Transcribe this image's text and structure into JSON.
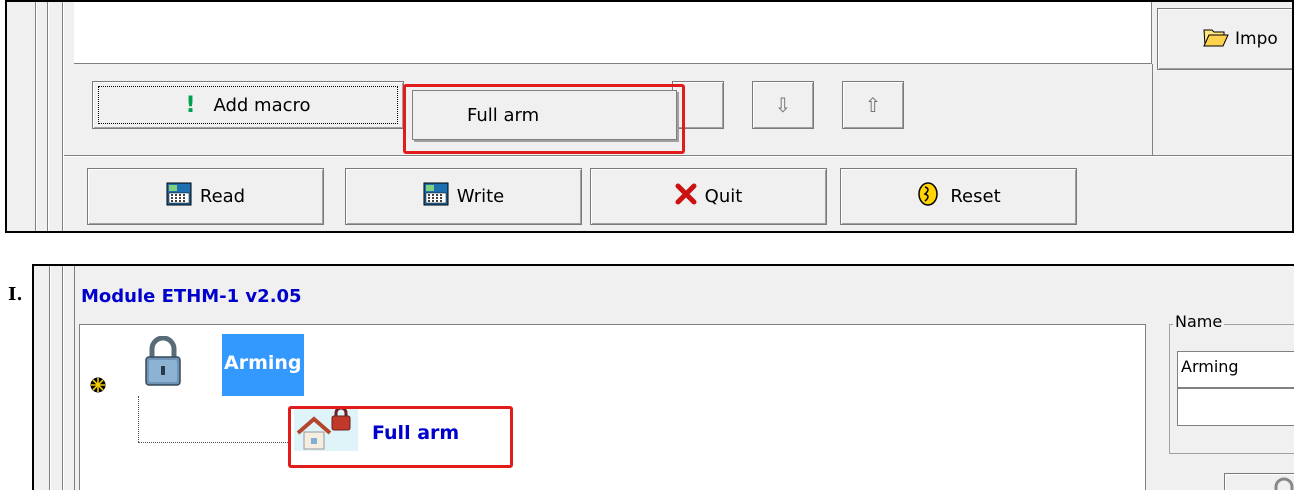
{
  "top_panel": {
    "import_button_label": "Impo",
    "add_macro_label": "Add macro",
    "dropdown_item": "Full arm",
    "arrow_down_symbol": "⇩",
    "arrow_up_symbol": "⇧",
    "read_label": "Read",
    "write_label": "Write",
    "quit_label": "Quit",
    "reset_label": "Reset"
  },
  "bottom_panel": {
    "left_letter": "I.",
    "module_title": "Module ETHM-1 v2.05",
    "tree_root": "Arming",
    "tree_child": "Full arm",
    "name_group_label": "Name",
    "name_value": "Arming",
    "name_second_value": ""
  },
  "colors": {
    "title_blue": "#0000cc",
    "selection_blue": "#3399ff",
    "highlight_red": "#e21b1b",
    "window_gray": "#f0f0f0"
  }
}
